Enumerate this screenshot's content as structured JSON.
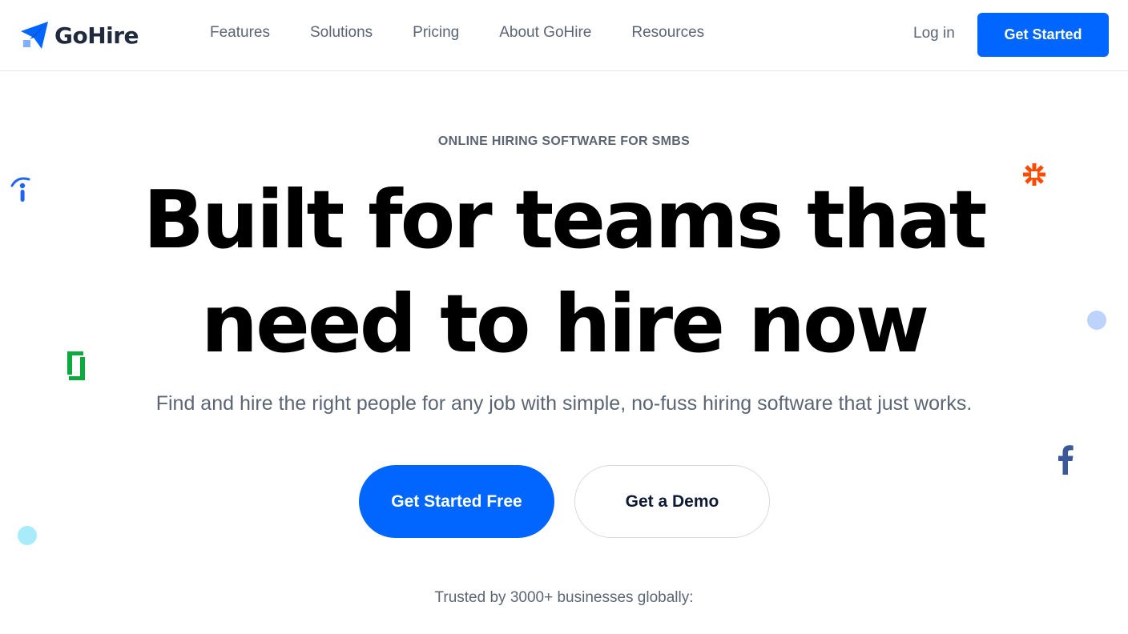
{
  "brand": {
    "name": "GoHire",
    "accent": "#0066ff"
  },
  "header": {
    "nav": [
      {
        "label": "Features"
      },
      {
        "label": "Solutions"
      },
      {
        "label": "Pricing"
      },
      {
        "label": "About GoHire"
      },
      {
        "label": "Resources"
      }
    ],
    "login_label": "Log in",
    "cta_label": "Get Started"
  },
  "hero": {
    "eyebrow": "ONLINE HIRING SOFTWARE FOR SMBS",
    "headline_line1": "Built for teams that",
    "headline_line2": "need to hire now",
    "subhead": "Find and hire the right people for any job with simple, no-fuss hiring software that just works.",
    "primary_button": "Get Started Free",
    "secondary_button": "Get a Demo",
    "trusted_text": "Trusted by 3000+ businesses globally:"
  },
  "decor": {
    "icons": [
      "indeed-icon",
      "glassdoor-icon",
      "zapier-icon",
      "facebook-icon"
    ],
    "colors": {
      "indeed": "#2164f3",
      "glassdoor": "#0caa41",
      "zapier": "#ff4a00",
      "facebook": "#3b5998",
      "dot_cyan": "#a8ecfb",
      "dot_blue": "#bcd4fb"
    }
  }
}
